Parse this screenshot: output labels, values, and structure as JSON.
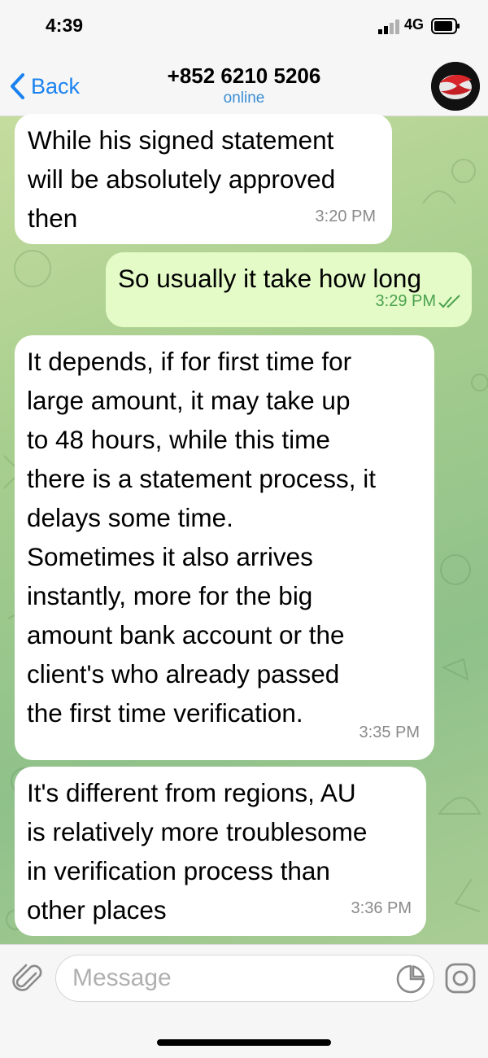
{
  "status_bar": {
    "time": "4:39",
    "network": "4G"
  },
  "header": {
    "back_label": "Back",
    "title": "+852 6210 5206",
    "status": "online"
  },
  "messages": [
    {
      "direction": "in",
      "text": "While his signed statement\nwill be absolutely approved\nthen",
      "time": "3:20 PM"
    },
    {
      "direction": "out",
      "text": "So usually it take how long",
      "time": "3:29 PM",
      "read": true
    },
    {
      "direction": "in",
      "text": "It depends, if for first time for\nlarge amount, it may take up\nto 48 hours, while this time\nthere is a statement process, it\ndelays some time.\nSometimes it also arrives\ninstantly, more for the big\namount bank account or the\nclient's who already passed\nthe first time verification.",
      "time": "3:35 PM"
    },
    {
      "direction": "in",
      "text": "It's different from regions, AU\nis relatively more troublesome\nin verification process than\nother places",
      "time": "3:36 PM"
    }
  ],
  "composer": {
    "placeholder": "Message"
  },
  "colors": {
    "accent": "#1a82f0",
    "online": "#3a8ed6",
    "outgoing_bubble": "#e4fbc8",
    "outgoing_time": "#4aa24d"
  }
}
